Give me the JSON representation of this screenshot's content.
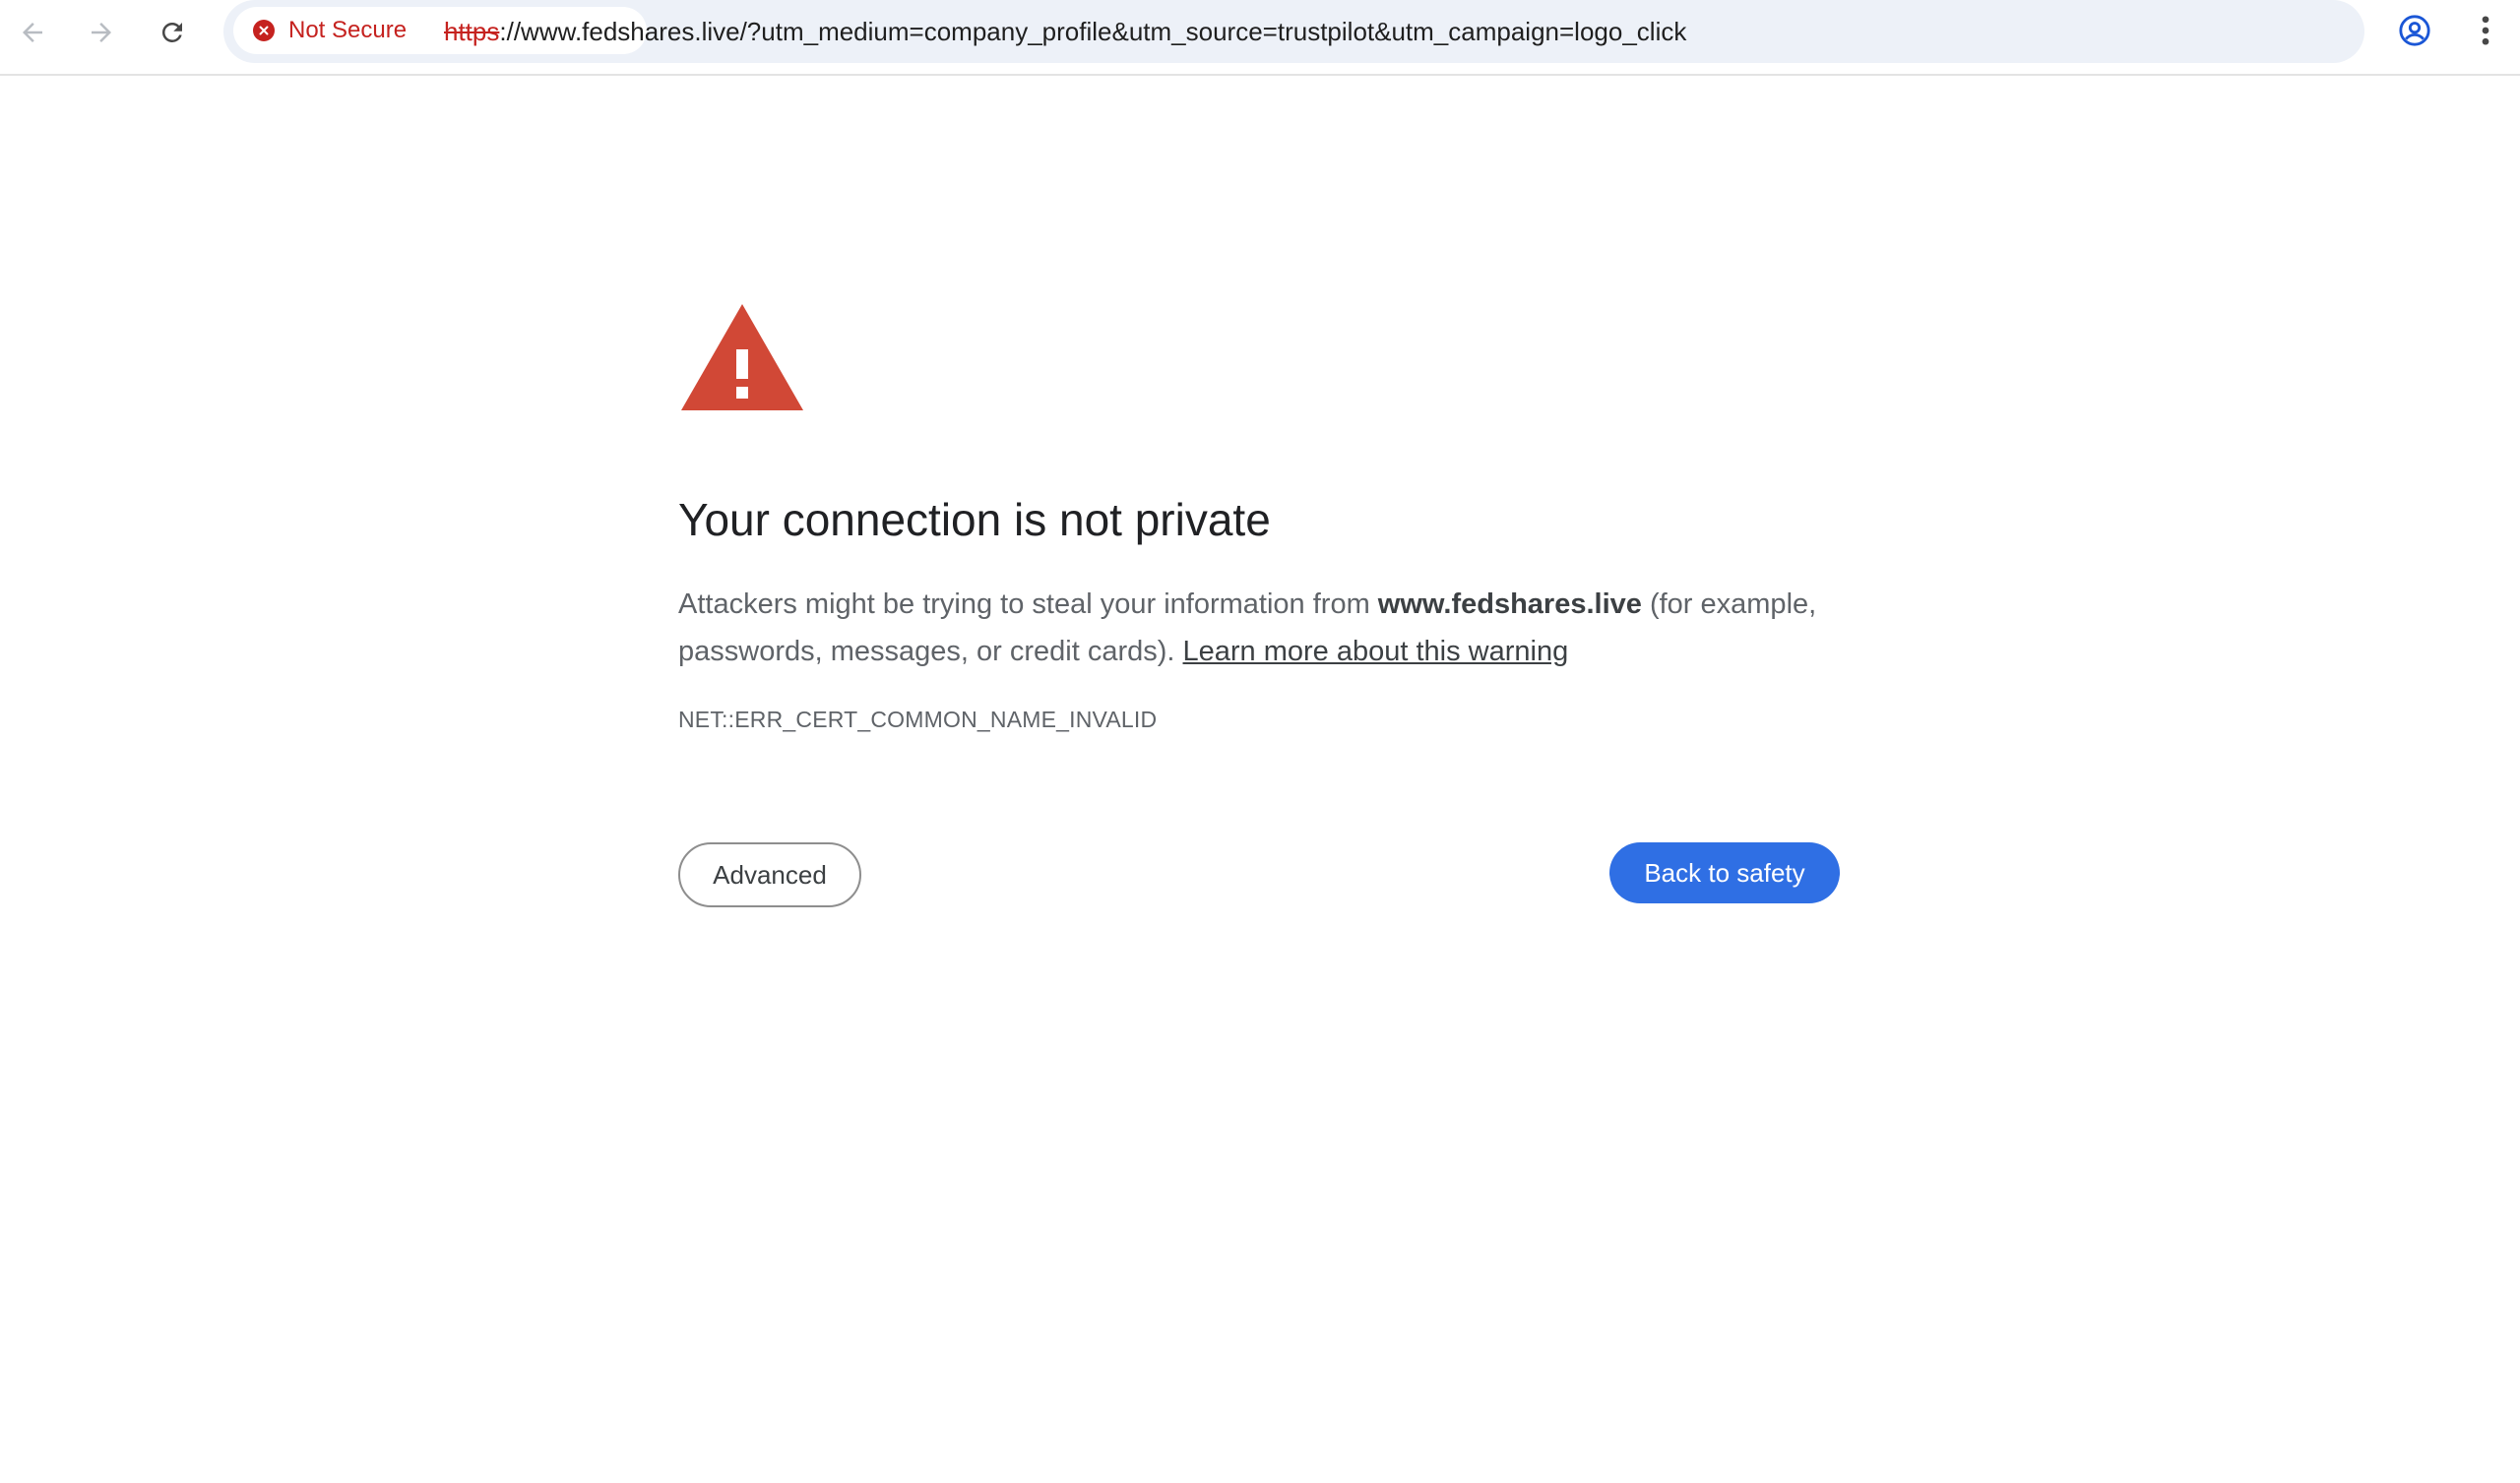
{
  "browser": {
    "address_bar": {
      "security_chip_label": "Not Secure",
      "url_scheme": "https",
      "url_rest": "://www.fedshares.live/?utm_medium=company_profile&utm_source=trustpilot&utm_campaign=logo_click"
    },
    "icons": {
      "back": "arrow-left-icon",
      "forward": "arrow-right-icon",
      "reload": "reload-icon",
      "security": "error-circle-icon",
      "bookmark": "star-icon",
      "profile": "profile-icon",
      "menu": "three-dot-menu-icon"
    },
    "colors": {
      "warning_red": "#c5221f",
      "omnibox_bg": "#edf1f8",
      "primary_button": "#2f6fe4",
      "warning_triangle": "#d14836"
    }
  },
  "interstitial": {
    "heading": "Your connection is not private",
    "description_prefix": "Attackers might be trying to steal your information from ",
    "domain": "www.fedshares.live",
    "description_suffix": " (for example, passwords, messages, or credit cards). ",
    "learn_more_link": "Learn more about this warning",
    "error_code": "NET::ERR_CERT_COMMON_NAME_INVALID",
    "advanced_button": "Advanced",
    "back_button": "Back to safety"
  }
}
